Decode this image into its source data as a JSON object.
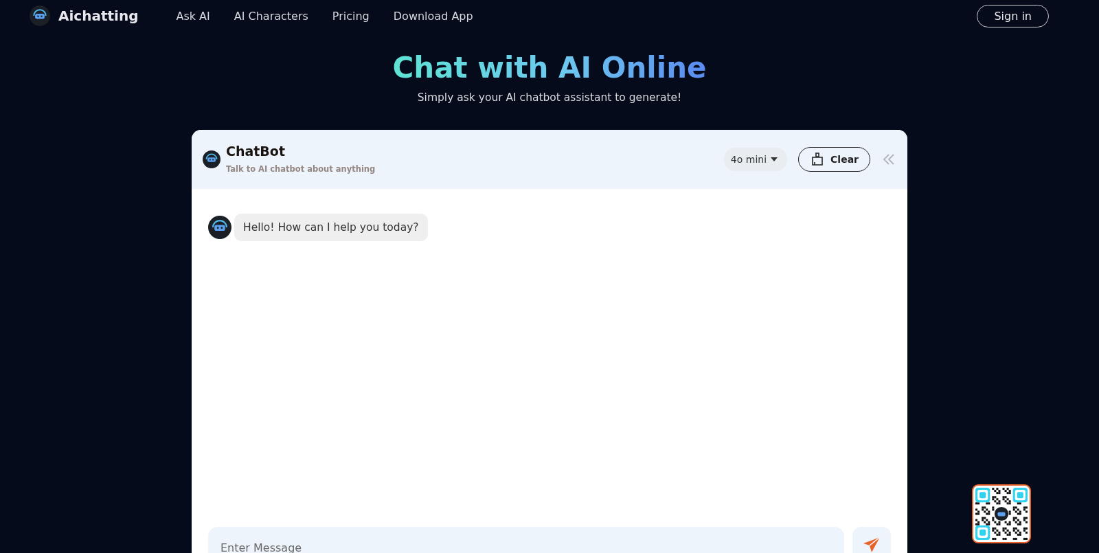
{
  "nav": {
    "brand": "Aichatting",
    "links": [
      "Ask AI",
      "AI Characters",
      "Pricing",
      "Download App"
    ],
    "sign_in": "Sign in"
  },
  "hero": {
    "title": "Chat with AI Online",
    "subtitle": "Simply ask your AI chatbot assistant to generate!"
  },
  "chat": {
    "title": "ChatBot",
    "subtitle": "Talk to AI chatbot about anything",
    "model": "4o mini",
    "clear": "Clear",
    "messages": [
      {
        "kind": "bot",
        "text": "Hello! How can I help you today?"
      }
    ],
    "input": {
      "placeholder": "Enter Message"
    }
  }
}
